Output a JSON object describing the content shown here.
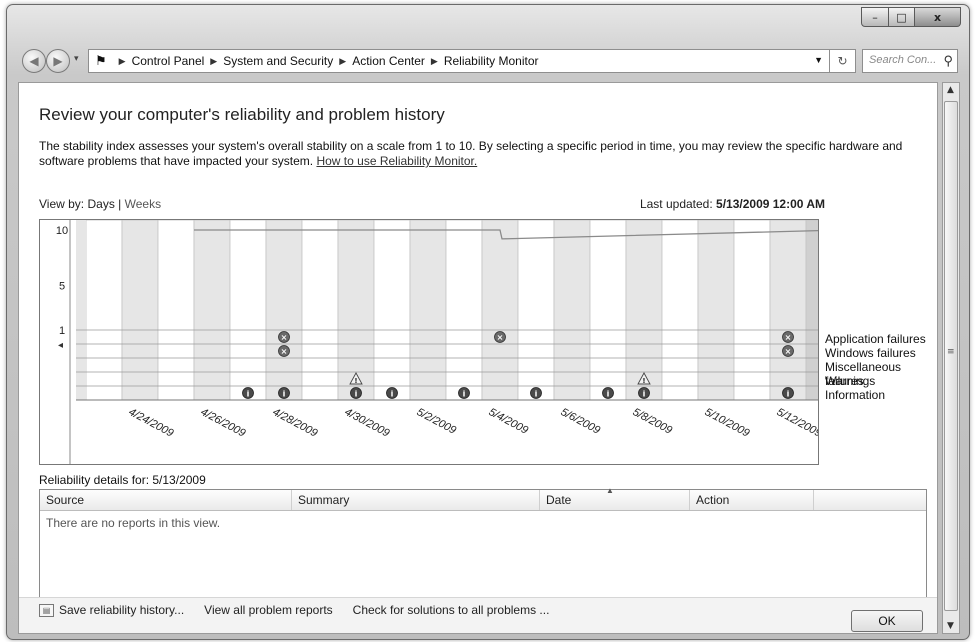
{
  "window": {
    "minimize_glyph": "–",
    "maximize_glyph": "□",
    "close_glyph": "x"
  },
  "nav": {
    "breadcrumb": [
      "Control Panel",
      "System and Security",
      "Action Center",
      "Reliability Monitor"
    ],
    "search_placeholder": "Search Con...",
    "icons": {
      "back": "back-arrow-icon",
      "forward": "forward-arrow-icon",
      "location": "flag-icon",
      "refresh": "refresh-icon",
      "search": "search-icon"
    }
  },
  "page": {
    "title": "Review your computer's reliability and problem history",
    "description": "The stability index assesses your system's overall stability on a scale from 1 to 10. By selecting a specific period in time, you may review the specific hardware and software problems that have impacted your system.",
    "help_link": "How to use Reliability Monitor."
  },
  "viewby": {
    "label": "View by:",
    "days": "Days",
    "separator": "|",
    "weeks": "Weeks"
  },
  "updated": {
    "label": "Last updated:",
    "value": "5/13/2009 12:00 AM"
  },
  "chart_data": {
    "type": "line",
    "title": "",
    "ylim": [
      1,
      10
    ],
    "y_ticks": [
      "10",
      "5",
      "1"
    ],
    "days": [
      "4/23",
      "4/24",
      "4/25",
      "4/26",
      "4/27",
      "4/28",
      "4/29",
      "4/30",
      "5/1",
      "5/2",
      "5/3",
      "5/4",
      "5/5",
      "5/6",
      "5/7",
      "5/8",
      "5/9",
      "5/10",
      "5/11",
      "5/12",
      "5/13"
    ],
    "x_tick_labels": [
      "4/24/2009",
      "4/26/2009",
      "4/28/2009",
      "4/30/2009",
      "5/2/2009",
      "5/4/2009",
      "5/6/2009",
      "5/8/2009",
      "5/10/2009",
      "5/12/2009"
    ],
    "stability_index": {
      "x": [
        "4/26",
        "5/4",
        "5/4",
        "5/13"
      ],
      "y": [
        10,
        10,
        9.2,
        10
      ]
    },
    "rows": [
      "Application failures",
      "Windows failures",
      "Miscellaneous failures",
      "Warnings",
      "Information"
    ],
    "events": [
      {
        "day": "4/28",
        "row": "Application failures",
        "icon": "error-icon"
      },
      {
        "day": "5/4",
        "row": "Application failures",
        "icon": "error-icon"
      },
      {
        "day": "5/12",
        "row": "Application failures",
        "icon": "error-icon"
      },
      {
        "day": "4/28",
        "row": "Windows failures",
        "icon": "error-icon"
      },
      {
        "day": "5/12",
        "row": "Windows failures",
        "icon": "error-icon"
      },
      {
        "day": "4/30",
        "row": "Warnings",
        "icon": "warning-icon"
      },
      {
        "day": "5/8",
        "row": "Warnings",
        "icon": "warning-icon"
      },
      {
        "day": "4/27",
        "row": "Information",
        "icon": "info-icon"
      },
      {
        "day": "4/28",
        "row": "Information",
        "icon": "info-icon"
      },
      {
        "day": "4/30",
        "row": "Information",
        "icon": "info-icon"
      },
      {
        "day": "5/1",
        "row": "Information",
        "icon": "info-icon"
      },
      {
        "day": "5/3",
        "row": "Information",
        "icon": "info-icon"
      },
      {
        "day": "5/5",
        "row": "Information",
        "icon": "info-icon"
      },
      {
        "day": "5/7",
        "row": "Information",
        "icon": "info-icon"
      },
      {
        "day": "5/8",
        "row": "Information",
        "icon": "info-icon"
      },
      {
        "day": "5/12",
        "row": "Information",
        "icon": "info-icon"
      }
    ],
    "selected_day": "5/13",
    "grid": true
  },
  "details": {
    "label": "Reliability details for: 5/13/2009",
    "columns": [
      "Source",
      "Summary",
      "Date",
      "Action"
    ],
    "empty_text": "There are no reports in this view."
  },
  "footer": {
    "save": "Save reliability history...",
    "view_all": "View all problem reports",
    "check": "Check for solutions to all problems ...",
    "ok": "OK"
  }
}
